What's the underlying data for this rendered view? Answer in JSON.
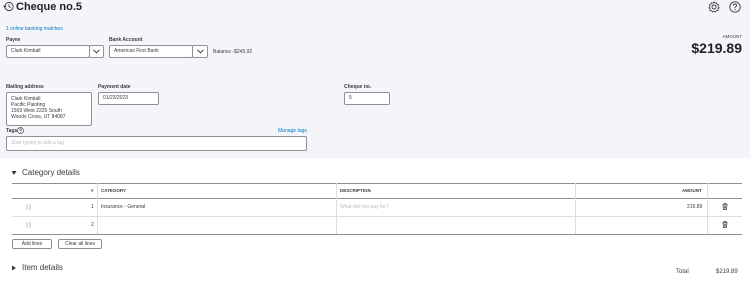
{
  "header": {
    "title": "Cheque no.5",
    "history_icon": "history-icon",
    "settings_icon": "gear-icon",
    "help_icon": "help-icon"
  },
  "banking_link": "1 online banking matches",
  "payee": {
    "label": "Payee",
    "value": "Clark Kimball"
  },
  "bank_account": {
    "label": "Bank Account",
    "value": "Americas First Bank",
    "balance": "Balance -$245.92"
  },
  "amount": {
    "label": "AMOUNT",
    "value": "$219.89"
  },
  "mailing": {
    "label": "Mailing address",
    "lines": [
      "Clark Kimball",
      "Pacific Painting",
      "1569 West 2225 South",
      "Woods Cross, UT  84087"
    ]
  },
  "payment_date": {
    "label": "Payment date",
    "value": "01/23/2023"
  },
  "cheque_no": {
    "label": "Cheque no.",
    "value": "5"
  },
  "tags": {
    "label": "Tags",
    "placeholder": "Start typing to add a tag",
    "manage": "Manage tags"
  },
  "category": {
    "title": "Category details",
    "columns": {
      "num": "#",
      "category": "CATEGORY",
      "description": "DESCRIPTION",
      "amount": "AMOUNT"
    },
    "rows": [
      {
        "num": "1",
        "category": "Insurance - General",
        "description_placeholder": "What did you pay for?",
        "amount": "219.89"
      },
      {
        "num": "2",
        "category": "",
        "description_placeholder": "",
        "amount": ""
      }
    ],
    "add_lines": "Add lines",
    "clear_lines": "Clear all lines"
  },
  "item_details": {
    "title": "Item details"
  },
  "total": {
    "label": "Total",
    "value": "$219.89"
  },
  "colors": {
    "link": "#0077c5",
    "header_bg": "#f4f5f8",
    "border": "#8d9096"
  }
}
